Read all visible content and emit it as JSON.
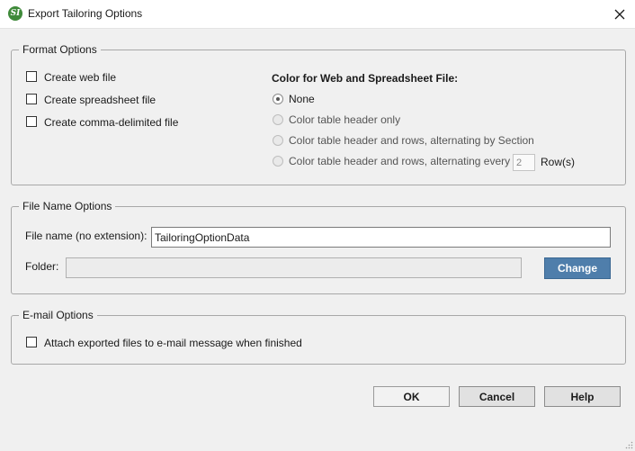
{
  "window": {
    "title": "Export Tailoring Options",
    "app_icon_text": "SI"
  },
  "format_options": {
    "legend": "Format Options",
    "checkboxes": [
      {
        "label": "Create web file",
        "checked": false
      },
      {
        "label": "Create spreadsheet file",
        "checked": false
      },
      {
        "label": "Create comma-delimited file",
        "checked": false
      }
    ],
    "color_heading": "Color for Web and Spreadsheet File:",
    "radios": [
      {
        "label": "None",
        "selected": true
      },
      {
        "label": "Color table header only",
        "selected": false
      },
      {
        "label": "Color table header and rows, alternating by Section",
        "selected": false
      },
      {
        "label": "Color table header and rows, alternating every",
        "selected": false
      }
    ],
    "rows_value": "2",
    "rows_suffix": "Row(s)"
  },
  "file_name_options": {
    "legend": "File Name Options",
    "file_name_label": "File name (no extension):",
    "file_name_value": "TailoringOptionData",
    "folder_label": "Folder:",
    "folder_value": "",
    "change_label": "Change"
  },
  "email_options": {
    "legend": "E-mail Options",
    "attach_label": "Attach exported files to e-mail message when finished",
    "attach_checked": false
  },
  "buttons": {
    "ok": "OK",
    "cancel": "Cancel",
    "help": "Help"
  },
  "colors": {
    "change_button": "#4f7eab",
    "app_icon": "#3f8a3a",
    "background": "#f0f0f0"
  }
}
